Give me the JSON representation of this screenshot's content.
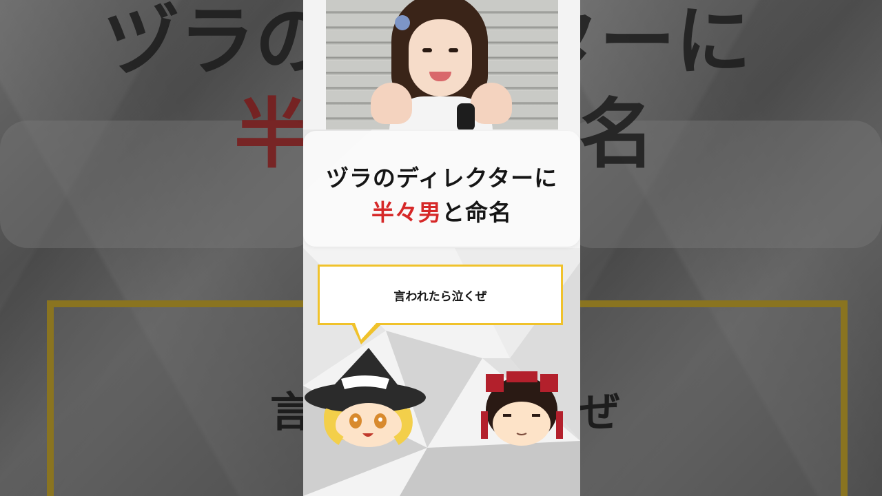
{
  "video": {
    "title_line1": "ヅラのディレクターに",
    "title_line2_highlight": "半々男",
    "title_line2_rest": "と命名",
    "speech_text": "言われたら泣くぜ",
    "bg_mirror_line1_left": "ヅラの",
    "bg_mirror_line1_right": "ターに",
    "bg_mirror_line2_left": "半",
    "bg_mirror_line2_right": "名",
    "bg_mirror_speech_left": "言",
    "bg_mirror_speech_right": "ぜ"
  },
  "colors": {
    "highlight": "#d62828",
    "bubble_border": "#f0c22b",
    "card_bg": "#fafafa"
  },
  "characters": [
    {
      "icon": "marisa-yukkuri-icon"
    },
    {
      "icon": "reimu-yukkuri-icon"
    }
  ]
}
